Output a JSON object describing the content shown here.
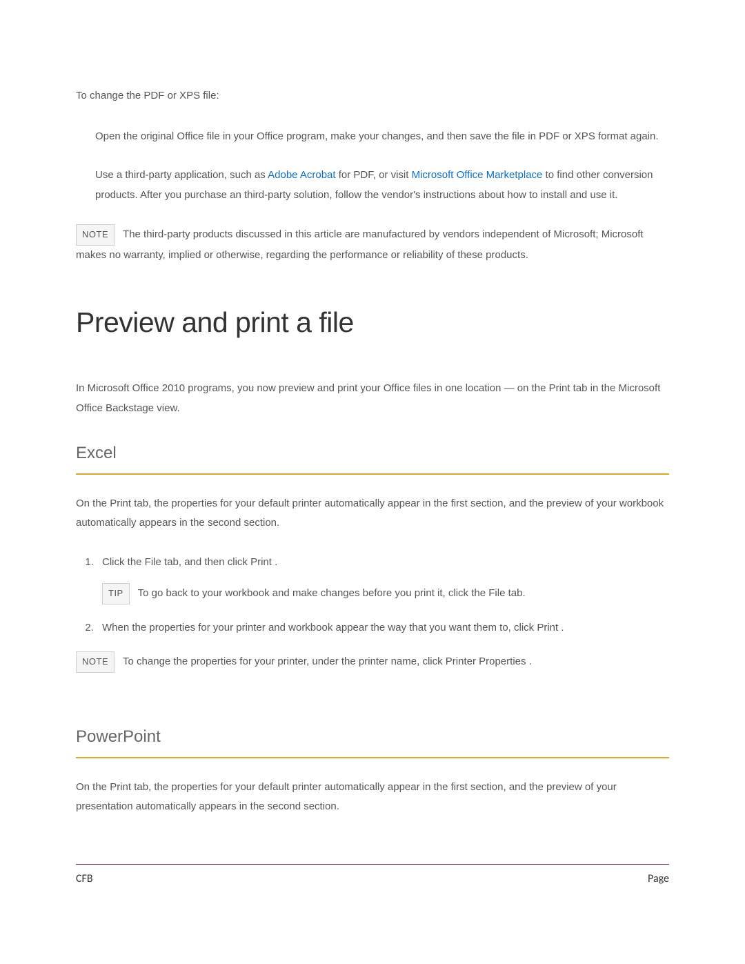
{
  "intro": "To change the PDF or XPS file:",
  "indented": {
    "p1": "Open the original Office file in your Office program, make your changes, and then save the file in PDF or XPS format again.",
    "p2_pre": "Use a third-party application, such as ",
    "link1": "Adobe Acrobat",
    "p2_mid": " for PDF, or visit ",
    "link2": "Microsoft Office Marketplace",
    "p2_post": " to find other conversion products. After you purchase an third-party solution, follow the vendor's instructions about how to install and use it."
  },
  "note1": {
    "badge": "NOTE",
    "text": "The third-party products discussed in this article are manufactured by vendors independent of Microsoft; Microsoft makes no warranty, implied or otherwise, regarding the performance or reliability of these products."
  },
  "heading_main": "Preview and print a file",
  "para_intro2": "In Microsoft Office 2010 programs, you now preview and print your Office files in one location — on the Print tab in the Microsoft Office Backstage view.",
  "heading_excel": "Excel",
  "excel_para": "On the Print tab, the properties for your default printer automatically appear in the first section, and the preview of your workbook automatically appears in the second section.",
  "steps": {
    "s1": "Click the File tab, and then click Print .",
    "tip_badge": "TIP",
    "tip_text": "To go back to your workbook and make changes before you print it, click the File tab.",
    "s2": "When the properties for your printer and workbook appear the way that you want them to, click Print ."
  },
  "note2": {
    "badge": "NOTE",
    "text": "To change the properties for your printer, under the printer name, click Printer Properties  ."
  },
  "heading_ppt": "PowerPoint",
  "ppt_para": "On the Print tab, the properties for your default printer automatically appear in the first section, and the preview of your presentation automatically appears in the second section.",
  "footer": {
    "left": "CFB",
    "right": "Page"
  }
}
